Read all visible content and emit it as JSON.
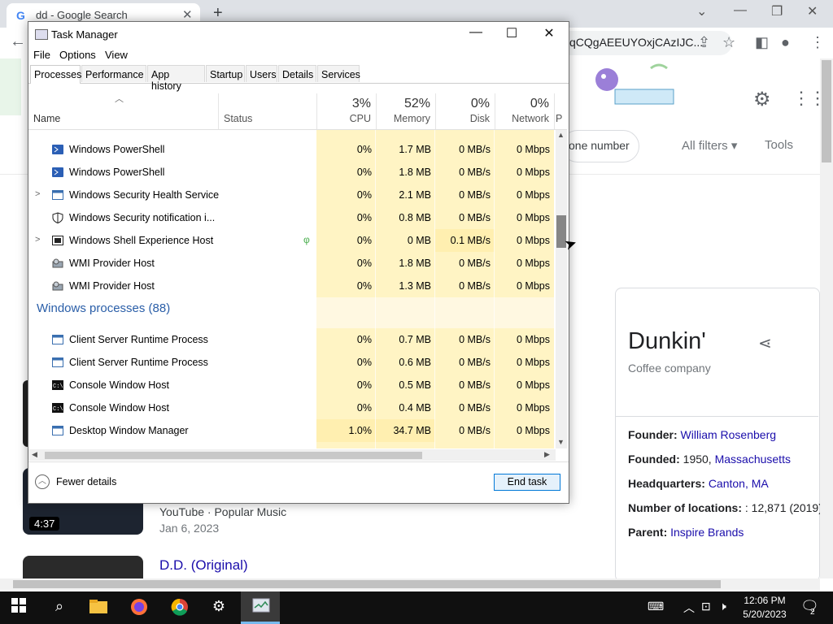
{
  "chrome": {
    "tab_title": "dd - Google Search",
    "tab_icon": "G",
    "new_tab": "+",
    "omnibox_text": "qCQgAEEUYOxjCAzIJC...",
    "minimize": "⌄",
    "back": "←"
  },
  "google": {
    "phone_chip": "one number",
    "all_filters": "All filters  ▾",
    "tools": "Tools",
    "kp_title": "Dunkin'",
    "kp_subtitle": "Coffee company",
    "kp_rows": [
      {
        "label": "Founder:",
        "value": "William Rosenberg",
        "prefix": ""
      },
      {
        "label": "Founded:",
        "prefix": "1950, ",
        "value": "Massachusetts"
      },
      {
        "label": "Headquarters:",
        "value": "Canton, MA",
        "prefix": ""
      },
      {
        "label": "Number of locations:",
        "prefix": ": 12,871 (2019)",
        "value": ""
      },
      {
        "label": "Parent:",
        "value": "Inspire Brands",
        "prefix": ""
      }
    ],
    "video1_duration": "4:37",
    "video1_source": "YouTube · Popular Music",
    "video1_date": "Jan 6, 2023",
    "video2_title": "D.D. (Original)"
  },
  "task_manager": {
    "title": "Task Manager",
    "menu": [
      "File",
      "Options",
      "View"
    ],
    "tabs": [
      "Processes",
      "Performance",
      "App history",
      "Startup",
      "Users",
      "Details",
      "Services"
    ],
    "active_tab": "Processes",
    "columns": {
      "name": "Name",
      "status": "Status",
      "cpu_pct": "3%",
      "cpu": "CPU",
      "mem_pct": "52%",
      "mem": "Memory",
      "disk_pct": "0%",
      "disk": "Disk",
      "net_pct": "0%",
      "net": "Network",
      "power": "P"
    },
    "rows": [
      {
        "name": "Windows PowerShell",
        "cpu": "0%",
        "mem": "1.7 MB",
        "disk": "0 MB/s",
        "net": "0 Mbps",
        "expander": ""
      },
      {
        "name": "Windows PowerShell",
        "cpu": "0%",
        "mem": "1.8 MB",
        "disk": "0 MB/s",
        "net": "0 Mbps",
        "expander": ""
      },
      {
        "name": "Windows Security Health Service",
        "cpu": "0%",
        "mem": "2.1 MB",
        "disk": "0 MB/s",
        "net": "0 Mbps",
        "expander": ">"
      },
      {
        "name": "Windows Security notification i...",
        "cpu": "0%",
        "mem": "0.8 MB",
        "disk": "0 MB/s",
        "net": "0 Mbps",
        "expander": ""
      },
      {
        "name": "Windows Shell Experience Host",
        "cpu": "0%",
        "mem": "0 MB",
        "disk": "0.1 MB/s",
        "net": "0 Mbps",
        "expander": ">"
      },
      {
        "name": "WMI Provider Host",
        "cpu": "0%",
        "mem": "1.8 MB",
        "disk": "0 MB/s",
        "net": "0 Mbps",
        "expander": ""
      },
      {
        "name": "WMI Provider Host",
        "cpu": "0%",
        "mem": "1.3 MB",
        "disk": "0 MB/s",
        "net": "0 Mbps",
        "expander": ""
      }
    ],
    "group_title": "Windows processes (88)",
    "rows2": [
      {
        "name": "Client Server Runtime Process",
        "cpu": "0%",
        "mem": "0.7 MB",
        "disk": "0 MB/s",
        "net": "0 Mbps"
      },
      {
        "name": "Client Server Runtime Process",
        "cpu": "0%",
        "mem": "0.6 MB",
        "disk": "0 MB/s",
        "net": "0 Mbps"
      },
      {
        "name": "Console Window Host",
        "cpu": "0%",
        "mem": "0.5 MB",
        "disk": "0 MB/s",
        "net": "0 Mbps"
      },
      {
        "name": "Console Window Host",
        "cpu": "0%",
        "mem": "0.4 MB",
        "disk": "0 MB/s",
        "net": "0 Mbps"
      },
      {
        "name": "Desktop Window Manager",
        "cpu": "1.0%",
        "mem": "34.7 MB",
        "disk": "0 MB/s",
        "net": "0 Mbps"
      }
    ],
    "fewer_details": "Fewer details",
    "end_task": "End task"
  },
  "taskbar": {
    "time": "12:06 PM",
    "date": "5/20/2023",
    "notifications": "2"
  }
}
